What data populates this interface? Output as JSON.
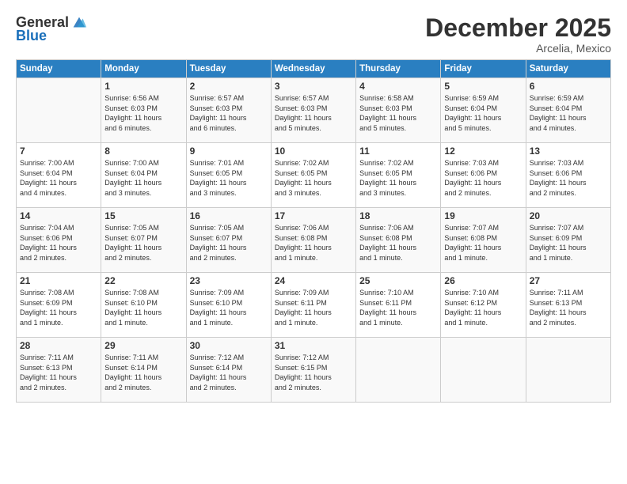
{
  "header": {
    "logo_line1": "General",
    "logo_line2": "Blue",
    "month": "December 2025",
    "location": "Arcelia, Mexico"
  },
  "weekdays": [
    "Sunday",
    "Monday",
    "Tuesday",
    "Wednesday",
    "Thursday",
    "Friday",
    "Saturday"
  ],
  "weeks": [
    [
      {
        "day": "",
        "info": ""
      },
      {
        "day": "1",
        "info": "Sunrise: 6:56 AM\nSunset: 6:03 PM\nDaylight: 11 hours\nand 6 minutes."
      },
      {
        "day": "2",
        "info": "Sunrise: 6:57 AM\nSunset: 6:03 PM\nDaylight: 11 hours\nand 6 minutes."
      },
      {
        "day": "3",
        "info": "Sunrise: 6:57 AM\nSunset: 6:03 PM\nDaylight: 11 hours\nand 5 minutes."
      },
      {
        "day": "4",
        "info": "Sunrise: 6:58 AM\nSunset: 6:03 PM\nDaylight: 11 hours\nand 5 minutes."
      },
      {
        "day": "5",
        "info": "Sunrise: 6:59 AM\nSunset: 6:04 PM\nDaylight: 11 hours\nand 5 minutes."
      },
      {
        "day": "6",
        "info": "Sunrise: 6:59 AM\nSunset: 6:04 PM\nDaylight: 11 hours\nand 4 minutes."
      }
    ],
    [
      {
        "day": "7",
        "info": "Sunrise: 7:00 AM\nSunset: 6:04 PM\nDaylight: 11 hours\nand 4 minutes."
      },
      {
        "day": "8",
        "info": "Sunrise: 7:00 AM\nSunset: 6:04 PM\nDaylight: 11 hours\nand 3 minutes."
      },
      {
        "day": "9",
        "info": "Sunrise: 7:01 AM\nSunset: 6:05 PM\nDaylight: 11 hours\nand 3 minutes."
      },
      {
        "day": "10",
        "info": "Sunrise: 7:02 AM\nSunset: 6:05 PM\nDaylight: 11 hours\nand 3 minutes."
      },
      {
        "day": "11",
        "info": "Sunrise: 7:02 AM\nSunset: 6:05 PM\nDaylight: 11 hours\nand 3 minutes."
      },
      {
        "day": "12",
        "info": "Sunrise: 7:03 AM\nSunset: 6:06 PM\nDaylight: 11 hours\nand 2 minutes."
      },
      {
        "day": "13",
        "info": "Sunrise: 7:03 AM\nSunset: 6:06 PM\nDaylight: 11 hours\nand 2 minutes."
      }
    ],
    [
      {
        "day": "14",
        "info": "Sunrise: 7:04 AM\nSunset: 6:06 PM\nDaylight: 11 hours\nand 2 minutes."
      },
      {
        "day": "15",
        "info": "Sunrise: 7:05 AM\nSunset: 6:07 PM\nDaylight: 11 hours\nand 2 minutes."
      },
      {
        "day": "16",
        "info": "Sunrise: 7:05 AM\nSunset: 6:07 PM\nDaylight: 11 hours\nand 2 minutes."
      },
      {
        "day": "17",
        "info": "Sunrise: 7:06 AM\nSunset: 6:08 PM\nDaylight: 11 hours\nand 1 minute."
      },
      {
        "day": "18",
        "info": "Sunrise: 7:06 AM\nSunset: 6:08 PM\nDaylight: 11 hours\nand 1 minute."
      },
      {
        "day": "19",
        "info": "Sunrise: 7:07 AM\nSunset: 6:08 PM\nDaylight: 11 hours\nand 1 minute."
      },
      {
        "day": "20",
        "info": "Sunrise: 7:07 AM\nSunset: 6:09 PM\nDaylight: 11 hours\nand 1 minute."
      }
    ],
    [
      {
        "day": "21",
        "info": "Sunrise: 7:08 AM\nSunset: 6:09 PM\nDaylight: 11 hours\nand 1 minute."
      },
      {
        "day": "22",
        "info": "Sunrise: 7:08 AM\nSunset: 6:10 PM\nDaylight: 11 hours\nand 1 minute."
      },
      {
        "day": "23",
        "info": "Sunrise: 7:09 AM\nSunset: 6:10 PM\nDaylight: 11 hours\nand 1 minute."
      },
      {
        "day": "24",
        "info": "Sunrise: 7:09 AM\nSunset: 6:11 PM\nDaylight: 11 hours\nand 1 minute."
      },
      {
        "day": "25",
        "info": "Sunrise: 7:10 AM\nSunset: 6:11 PM\nDaylight: 11 hours\nand 1 minute."
      },
      {
        "day": "26",
        "info": "Sunrise: 7:10 AM\nSunset: 6:12 PM\nDaylight: 11 hours\nand 1 minute."
      },
      {
        "day": "27",
        "info": "Sunrise: 7:11 AM\nSunset: 6:13 PM\nDaylight: 11 hours\nand 2 minutes."
      }
    ],
    [
      {
        "day": "28",
        "info": "Sunrise: 7:11 AM\nSunset: 6:13 PM\nDaylight: 11 hours\nand 2 minutes."
      },
      {
        "day": "29",
        "info": "Sunrise: 7:11 AM\nSunset: 6:14 PM\nDaylight: 11 hours\nand 2 minutes."
      },
      {
        "day": "30",
        "info": "Sunrise: 7:12 AM\nSunset: 6:14 PM\nDaylight: 11 hours\nand 2 minutes."
      },
      {
        "day": "31",
        "info": "Sunrise: 7:12 AM\nSunset: 6:15 PM\nDaylight: 11 hours\nand 2 minutes."
      },
      {
        "day": "",
        "info": ""
      },
      {
        "day": "",
        "info": ""
      },
      {
        "day": "",
        "info": ""
      }
    ]
  ]
}
